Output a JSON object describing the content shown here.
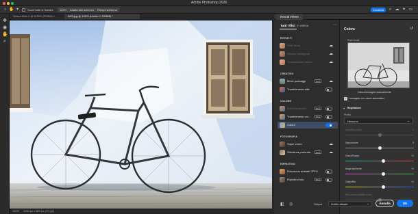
{
  "app": {
    "title": "Adobe Photoshop 2026"
  },
  "options_bar": {
    "show_transform": "Scorri tutte le finestre",
    "zoom": "100%",
    "fit_screen": "Adatta allo schermo",
    "fill_screen": "Riempi schermo",
    "share": "Condividi"
  },
  "tabs": [
    {
      "label": "Senza titolo-1 @ 8,33% (RGB/8) ×"
    },
    {
      "label": "IMG.jpg @ 100% (Livello 0, RGB/8) *"
    }
  ],
  "status": {
    "zoom": "100%",
    "info": "1054 px x 800 px (72 ppi)"
  },
  "neural_filters": {
    "panel_title": "Neural Filters",
    "tabs": {
      "all": "Tutti i filtri",
      "wait": "In attesa"
    },
    "sections": {
      "portraits": "RITRATTI",
      "creative": "CREATIVO",
      "color": "COLORE",
      "photography": "FOTOGRAFIA",
      "restore": "RIPRISTINO"
    },
    "filters": {
      "skin": "Pelle liscia",
      "smart_portrait": "Ritratto intelligente",
      "makeup": "Trasferimento trucco",
      "landscape": "Mixer paesaggi",
      "style": "Trasferimento stile",
      "harmony": "Armonizzazione",
      "color_transfer": "Trasferimento col...",
      "colorize": "Colora",
      "super_zoom": "Super zoom",
      "depth_blur": "Sfocatura profonda",
      "jpeg": "Rimozione artefatti JPEG",
      "photo_restore": "Ripristino foto"
    },
    "beta_badge": "Beta",
    "colorize_enabled": true,
    "output_label": "Output",
    "output_value": "Livello attuale",
    "cancel": "Annulla",
    "ok": "OK"
  },
  "colorize_panel": {
    "title": "Colora",
    "focus_label": "Punti focali",
    "preview_caption": "Colora immagine manualmente",
    "auto_color_label": "Immagine con colore automatico",
    "auto_color_checked": true,
    "adjustments_label": "Regolazioni",
    "profile_label": "Profilo",
    "profile_value": "Nessuno",
    "sliders": [
      {
        "label": "Intensità profilo",
        "value": "0",
        "position": 0.5,
        "enabled": false,
        "track": "#4a4a4a"
      },
      {
        "label": "Saturazione",
        "value": "0",
        "position": 0.5,
        "enabled": true,
        "track": "#8a8a8a"
      },
      {
        "label": "Ciano/Rosso",
        "value": "+1",
        "position": 0.55,
        "enabled": true,
        "track_from": "#17c3c3",
        "track_to": "#e23a3a"
      },
      {
        "label": "Magenta/Verde",
        "value": "+1",
        "position": 0.55,
        "enabled": true,
        "track_from": "#d94fd2",
        "track_to": "#3cc14e"
      },
      {
        "label": "Giallo/Blu",
        "value": "+1",
        "position": 0.55,
        "enabled": true,
        "track_from": "#e8d233",
        "track_to": "#3a5be2"
      },
      {
        "label": "Riduzione artefatti colore",
        "value": "",
        "position": 0.5,
        "enabled": false,
        "track": "#4a4a4a"
      }
    ]
  },
  "colors": {
    "accent": "#1473e6",
    "selected_row": "#3e4d63"
  }
}
